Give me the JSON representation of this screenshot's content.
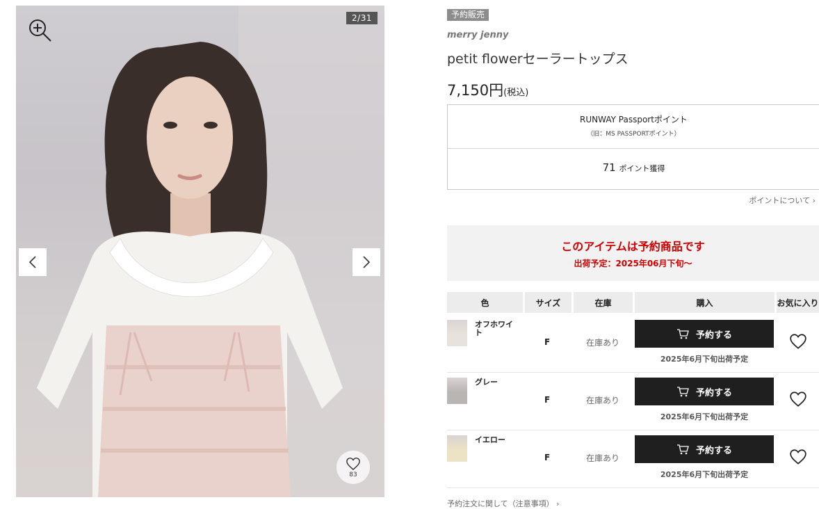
{
  "gallery": {
    "counter": "2/31",
    "favorite_count": "83",
    "icons": [
      "zoom-in-icon",
      "chevron-left-icon",
      "chevron-right-icon",
      "heart-icon"
    ]
  },
  "product": {
    "badge": "予約販売",
    "brand": "merry jenny",
    "name": "petit flowerセーラートップス",
    "price": "7,150円",
    "tax": "(税込)"
  },
  "points": {
    "title": "RUNWAY Passportポイント",
    "subtitle": "（旧：MS PASSPORTポイント）",
    "value": "71",
    "unit": "ポイント獲得",
    "link": "ポイントについて ›"
  },
  "notice": {
    "title": "このアイテムは予約商品です",
    "date": "出荷予定：2025年06月下旬〜"
  },
  "table": {
    "headers": {
      "color": "色",
      "size": "サイズ",
      "stock": "在庫",
      "buy": "購入",
      "fav": "お気に入り"
    },
    "rows": [
      {
        "color": "オフホワイト",
        "size": "F",
        "stock": "在庫あり",
        "button": "予約する",
        "ship": "2025年6月下旬出荷予定",
        "thumb_color": "#e8e2dc"
      },
      {
        "color": "グレー",
        "size": "F",
        "stock": "在庫あり",
        "button": "予約する",
        "ship": "2025年6月下旬出荷予定",
        "thumb_color": "#b9b5b3"
      },
      {
        "color": "イエロー",
        "size": "F",
        "stock": "在庫あり",
        "button": "予約する",
        "ship": "2025年6月下旬出荷予定",
        "thumb_color": "#ece3c4"
      }
    ]
  },
  "footer": {
    "link": "予約注文に関して（注意事項） ›"
  },
  "colors": {
    "accent_red": "#d00000",
    "button_dark": "#1f1f1f",
    "badge_gray": "#8c8c8c"
  }
}
